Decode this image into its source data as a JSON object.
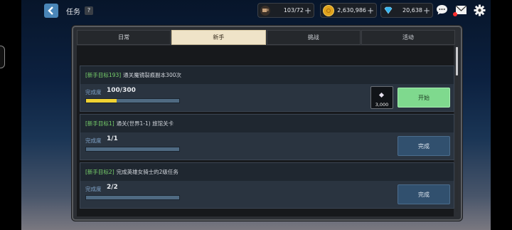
{
  "header": {
    "title": "任务",
    "help": "?"
  },
  "resources": [
    {
      "icon": "stamina-cup-icon",
      "value": "103/72",
      "color": "#c6a07a"
    },
    {
      "icon": "gold-coin-icon",
      "value": "2,630,986",
      "color": "#e0a21c"
    },
    {
      "icon": "diamond-gem-icon",
      "value": "20,638",
      "color": "#36b5f0"
    }
  ],
  "tabs": [
    {
      "label": "日常",
      "active": false
    },
    {
      "label": "新手",
      "active": true
    },
    {
      "label": "挑战",
      "active": false
    },
    {
      "label": "活动",
      "active": false
    }
  ],
  "quests": [
    {
      "tag": "[新手目标193]",
      "title": "通关魔镜裂痕副本300次",
      "progress_label": "完成度",
      "progress": "100/300",
      "fill": 0.33,
      "action": "开始",
      "reward_count": "3,000"
    },
    {
      "tag": "[新手目标1]",
      "title": "通关(世界1-1) 旅馆关卡",
      "progress_label": "完成度",
      "progress": "1/1",
      "fill": 1.0,
      "action": "完成"
    },
    {
      "tag": "[新手目标2]",
      "title": "完成英雄女骑士的2级任务",
      "progress_label": "完成度",
      "progress": "2/2",
      "fill": 1.0,
      "action": "完成"
    }
  ]
}
